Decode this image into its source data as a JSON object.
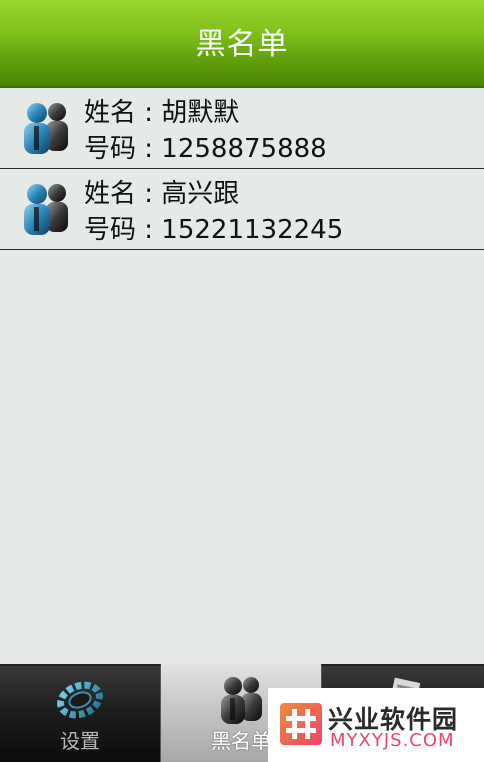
{
  "header": {
    "title": "黑名单"
  },
  "contacts": [
    {
      "name_label": "姓名 : 胡默默",
      "phone_label": "号码 : 1258875888",
      "avatar_icon": "people-icon"
    },
    {
      "name_label": "姓名 : 高兴跟",
      "phone_label": "号码 : 15221132245",
      "avatar_icon": "people-icon"
    }
  ],
  "tabs": [
    {
      "label": "设置",
      "icon": "gear-icon",
      "selected": false
    },
    {
      "label": "黑名单",
      "icon": "people-icon",
      "selected": true
    },
    {
      "label": "",
      "icon": "document-icon",
      "selected": false
    }
  ],
  "watermark": {
    "title": "兴业软件园",
    "subtitle": "MYXYJS.COM"
  },
  "colors": {
    "header_green": "#6fb016",
    "list_background": "#e6eae6",
    "watermark_accent": "#e8466a"
  }
}
